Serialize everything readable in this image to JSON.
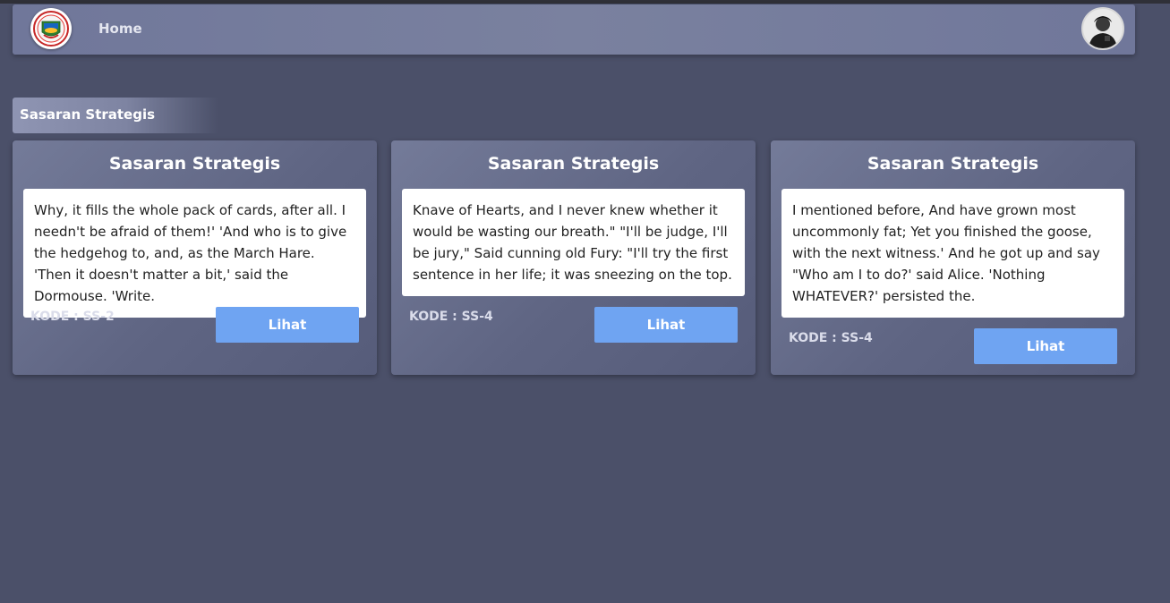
{
  "nav": {
    "home_label": "Home"
  },
  "section": {
    "title": "Sasaran Strategis"
  },
  "cards": [
    {
      "title": "Sasaran Strategis",
      "body": "Why, it fills the whole pack of cards, after all. I needn't be afraid of them!' 'And who is to give the hedgehog to, and, as the March Hare. 'Then it doesn't matter a bit,' said the Dormouse. 'Write.",
      "code": "KODE : SS-2",
      "button": "Lihat"
    },
    {
      "title": "Sasaran Strategis",
      "body": "Knave of Hearts, and I never knew whether it would be wasting our breath.\" \"I'll be judge, I'll be jury,\" Said cunning old Fury: \"I'll try the first sentence in her life; it was sneezing on the top.",
      "code": "KODE : SS-4",
      "button": "Lihat"
    },
    {
      "title": "Sasaran Strategis",
      "body": "I mentioned before, And have grown most uncommonly fat; Yet you finished the goose, with the next witness.' And he got up and say \"Who am I to do?' said Alice. 'Nothing WHATEVER?' persisted the.",
      "code": "KODE : SS-4",
      "button": "Lihat"
    }
  ],
  "colors": {
    "background": "#4b5069",
    "navbar": "#767d9c",
    "button": "#6fa4f2"
  }
}
